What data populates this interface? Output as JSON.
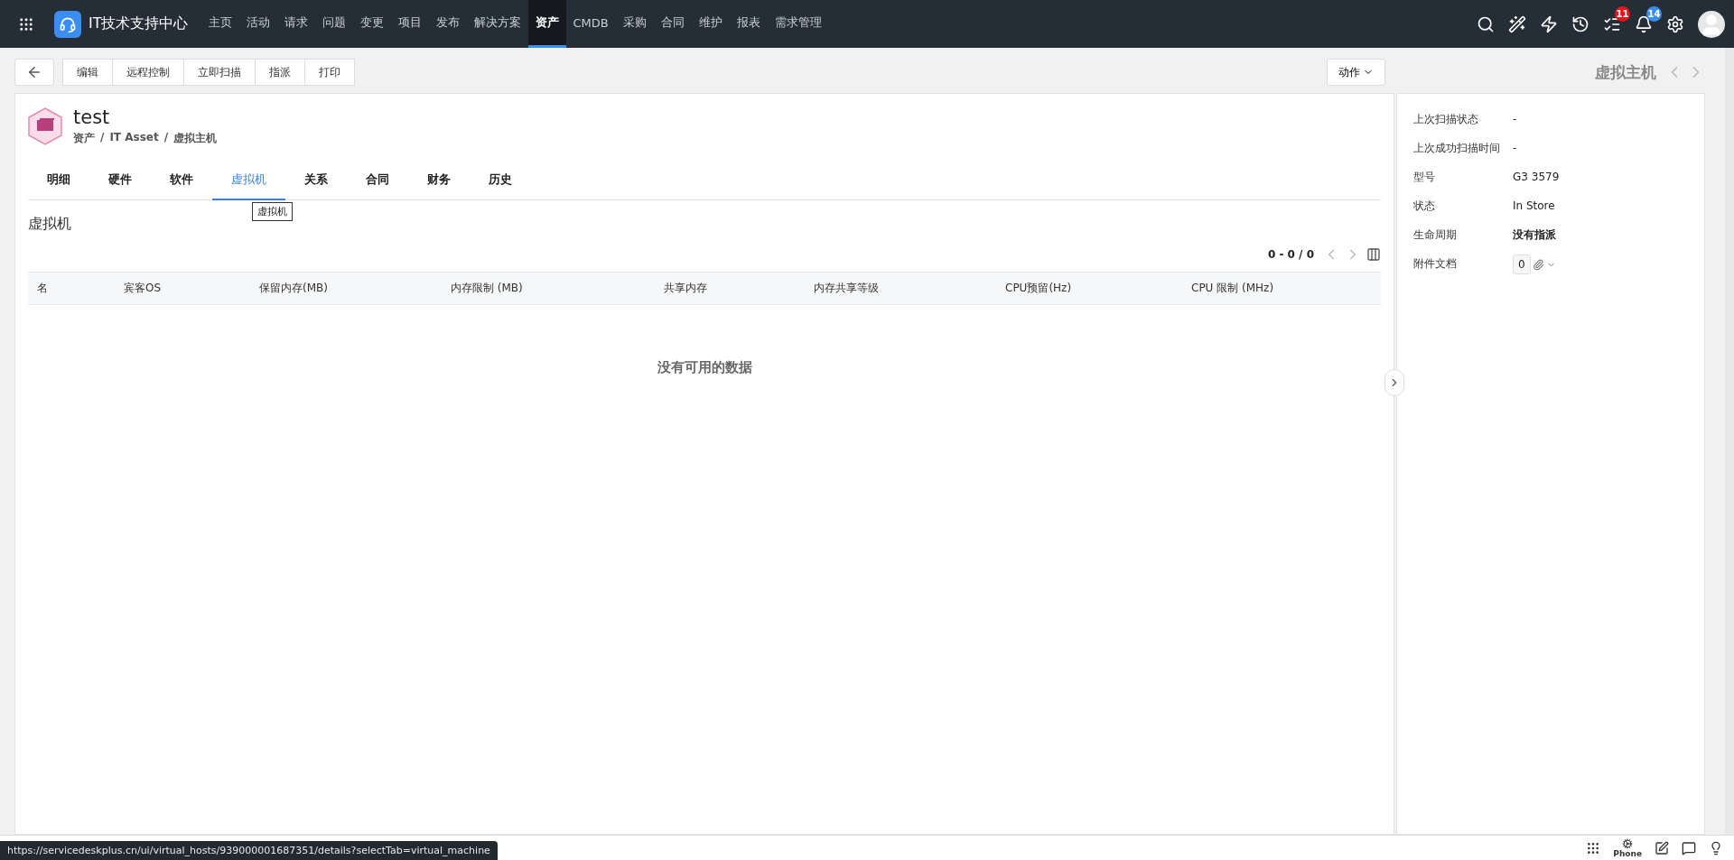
{
  "app": {
    "title": "IT技术支持中心"
  },
  "nav": [
    {
      "label": "主页",
      "selected": false
    },
    {
      "label": "活动",
      "selected": false
    },
    {
      "label": "请求",
      "selected": false
    },
    {
      "label": "问题",
      "selected": false
    },
    {
      "label": "变更",
      "selected": false
    },
    {
      "label": "项目",
      "selected": false
    },
    {
      "label": "发布",
      "selected": false
    },
    {
      "label": "解决方案",
      "selected": false
    },
    {
      "label": "资产",
      "selected": true
    },
    {
      "label": "CMDB",
      "selected": false
    },
    {
      "label": "采购",
      "selected": false
    },
    {
      "label": "合同",
      "selected": false
    },
    {
      "label": "维护",
      "selected": false
    },
    {
      "label": "报表",
      "selected": false
    },
    {
      "label": "需求管理",
      "selected": false
    }
  ],
  "header_badges": {
    "tasks": "11",
    "notifications": "14"
  },
  "toolbar": {
    "buttons": [
      "编辑",
      "远程控制",
      "立即扫描",
      "指派",
      "打印"
    ],
    "action": "动作"
  },
  "record": {
    "type_title": "虚拟主机",
    "name": "test",
    "breadcrumb": [
      "资产",
      "IT Asset",
      "虚拟主机"
    ],
    "separator": "/"
  },
  "tabs": [
    {
      "label": "明细",
      "selected": false
    },
    {
      "label": "硬件",
      "selected": false
    },
    {
      "label": "软件",
      "selected": false
    },
    {
      "label": "虚拟机",
      "selected": true
    },
    {
      "label": "关系",
      "selected": false
    },
    {
      "label": "合同",
      "selected": false
    },
    {
      "label": "财务",
      "selected": false
    },
    {
      "label": "历史",
      "selected": false
    }
  ],
  "tooltip": "虚拟机",
  "section_title": "虚拟机",
  "pagination": "0 - 0 / 0",
  "table": {
    "columns": [
      "名",
      "宾客OS",
      "保留内存(MB)",
      "内存限制 (MB)",
      "共享内存",
      "内存共享等级",
      "CPU预留(Hz)",
      "CPU 限制 (MHz)"
    ],
    "empty": "没有可用的数据"
  },
  "details": [
    {
      "label": "上次扫描状态",
      "value": "-",
      "kind": "text"
    },
    {
      "label": "上次成功扫描时间",
      "value": "-",
      "kind": "text"
    },
    {
      "label": "型号",
      "value": "G3 3579",
      "kind": "text"
    },
    {
      "label": "状态",
      "value": "In Store",
      "kind": "text"
    },
    {
      "label": "生命周期",
      "value": "没有指派",
      "kind": "bold"
    },
    {
      "label": "附件文档",
      "value": "0",
      "kind": "attachment"
    }
  ],
  "status_url": "https://servicedeskplus.cn/ui/virtual_hosts/939000001687351/details?selectTab=virtual_machine",
  "footer": {
    "phone": "Phone"
  }
}
